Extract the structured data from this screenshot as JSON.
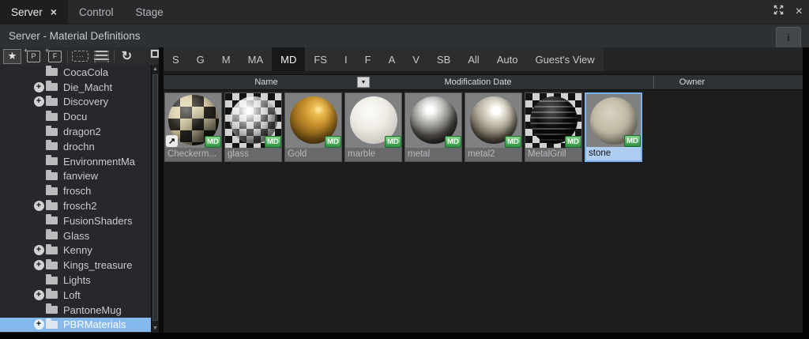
{
  "top_tabs": {
    "items": [
      {
        "label": "Server",
        "active": true,
        "closable": true
      },
      {
        "label": "Control",
        "active": false
      },
      {
        "label": "Stage",
        "active": false
      }
    ]
  },
  "title_bar": {
    "title": "Server - Material Definitions",
    "info_label": "i"
  },
  "left_toolbar": {
    "buttons": [
      "favorites-star",
      "add-project",
      "add-file",
      "dashed-selection",
      "thumbnail-list",
      "refresh"
    ]
  },
  "filter_tabs": {
    "selected": "MD",
    "items": [
      {
        "label": "S"
      },
      {
        "label": "G"
      },
      {
        "label": "M"
      },
      {
        "label": "MA"
      },
      {
        "label": "MD",
        "selected": true
      },
      {
        "label": "FS"
      },
      {
        "label": "I"
      },
      {
        "label": "F"
      },
      {
        "label": "A"
      },
      {
        "label": "V"
      },
      {
        "label": "SB"
      },
      {
        "label": "All"
      },
      {
        "label": "Auto"
      },
      {
        "label": "Guest's View"
      }
    ]
  },
  "list_header": {
    "name": "Name",
    "modification_date": "Modification Date",
    "owner": "Owner"
  },
  "tree": {
    "selected": "PBRMaterials",
    "items": [
      {
        "label": "CocaCola"
      },
      {
        "label": "Die_Macht",
        "expand": true
      },
      {
        "label": "Discovery",
        "expand": true
      },
      {
        "label": "Docu"
      },
      {
        "label": "dragon2"
      },
      {
        "label": "drochn"
      },
      {
        "label": "EnvironmentMa"
      },
      {
        "label": "fanview"
      },
      {
        "label": "frosch"
      },
      {
        "label": "frosch2",
        "expand": true
      },
      {
        "label": "FusionShaders"
      },
      {
        "label": "Glass"
      },
      {
        "label": "Kenny",
        "expand": true
      },
      {
        "label": "Kings_treasure",
        "expand": true
      },
      {
        "label": "Lights"
      },
      {
        "label": "Loft",
        "expand": true
      },
      {
        "label": "PantoneMug"
      },
      {
        "label": "PBRMaterials",
        "expand": true,
        "selected": true
      }
    ]
  },
  "materials": {
    "selected": "stone",
    "items": [
      {
        "name": "Checkerm...",
        "style": "checker",
        "badge": "MD",
        "shortcut": true
      },
      {
        "name": "glass",
        "style": "glass",
        "badge": "MD",
        "checkerbg": true
      },
      {
        "name": "Gold",
        "style": "gold",
        "badge": "MD"
      },
      {
        "name": "marble",
        "style": "marble",
        "badge": "MD"
      },
      {
        "name": "metal",
        "style": "metal",
        "badge": "MD"
      },
      {
        "name": "metal2",
        "style": "metal2",
        "badge": "MD"
      },
      {
        "name": "MetalGrill",
        "style": "grill",
        "badge": "MD",
        "checkerbg": true
      },
      {
        "name": "stone",
        "style": "stone",
        "badge": "MD",
        "selected": true
      }
    ]
  },
  "colors": {
    "selection_blue": "#85b9ee",
    "tile_selected_border": "#7fb2ec",
    "badge_green_top": "#82d287",
    "badge_green_bottom": "#2d9040",
    "panel_dark": "#1b1d1f",
    "bar_gray": "#2b2d2f"
  }
}
